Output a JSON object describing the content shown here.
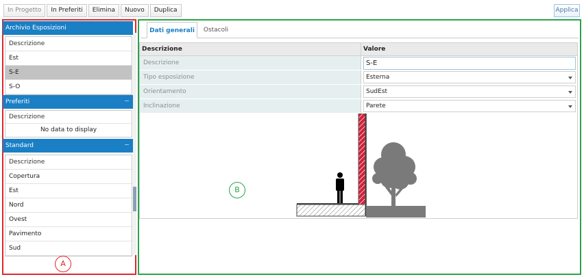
{
  "toolbar": {
    "in_progetto": "In Progetto",
    "in_preferiti": "In Preferiti",
    "elimina": "Elimina",
    "nuovo": "Nuovo",
    "duplica": "Duplica",
    "applica": "Applica"
  },
  "archivio": {
    "title": "Archivio Esposizioni",
    "header": "Descrizione",
    "items": [
      "Est",
      "S-E",
      "S-O"
    ],
    "selected": "S-E"
  },
  "preferiti": {
    "title": "Preferiti",
    "header": "Descrizione",
    "empty": "No data to display"
  },
  "standard": {
    "title": "Standard",
    "header": "Descrizione",
    "items": [
      "Copertura",
      "Est",
      "Nord",
      "Ovest",
      "Pavimento",
      "Sud"
    ]
  },
  "annotations": {
    "a": "A",
    "b": "B"
  },
  "tabs": {
    "dati_generali": "Dati generali",
    "ostacoli": "Ostacoli"
  },
  "grid": {
    "col_descrizione": "Descrizione",
    "col_valore": "Valore",
    "rows": [
      {
        "label": "Descrizione",
        "value": "S-E"
      },
      {
        "label": "Tipo esposizione",
        "value": "Esterna"
      },
      {
        "label": "Orientamento",
        "value": "SudEst"
      },
      {
        "label": "Inclinazione",
        "value": "Parete"
      }
    ]
  },
  "colors": {
    "header_blue": "#1a7fc4",
    "panel_a": "#e0252b",
    "panel_b": "#2aa34a",
    "wall": "#d1213a",
    "tree": "#7a7a7a"
  }
}
